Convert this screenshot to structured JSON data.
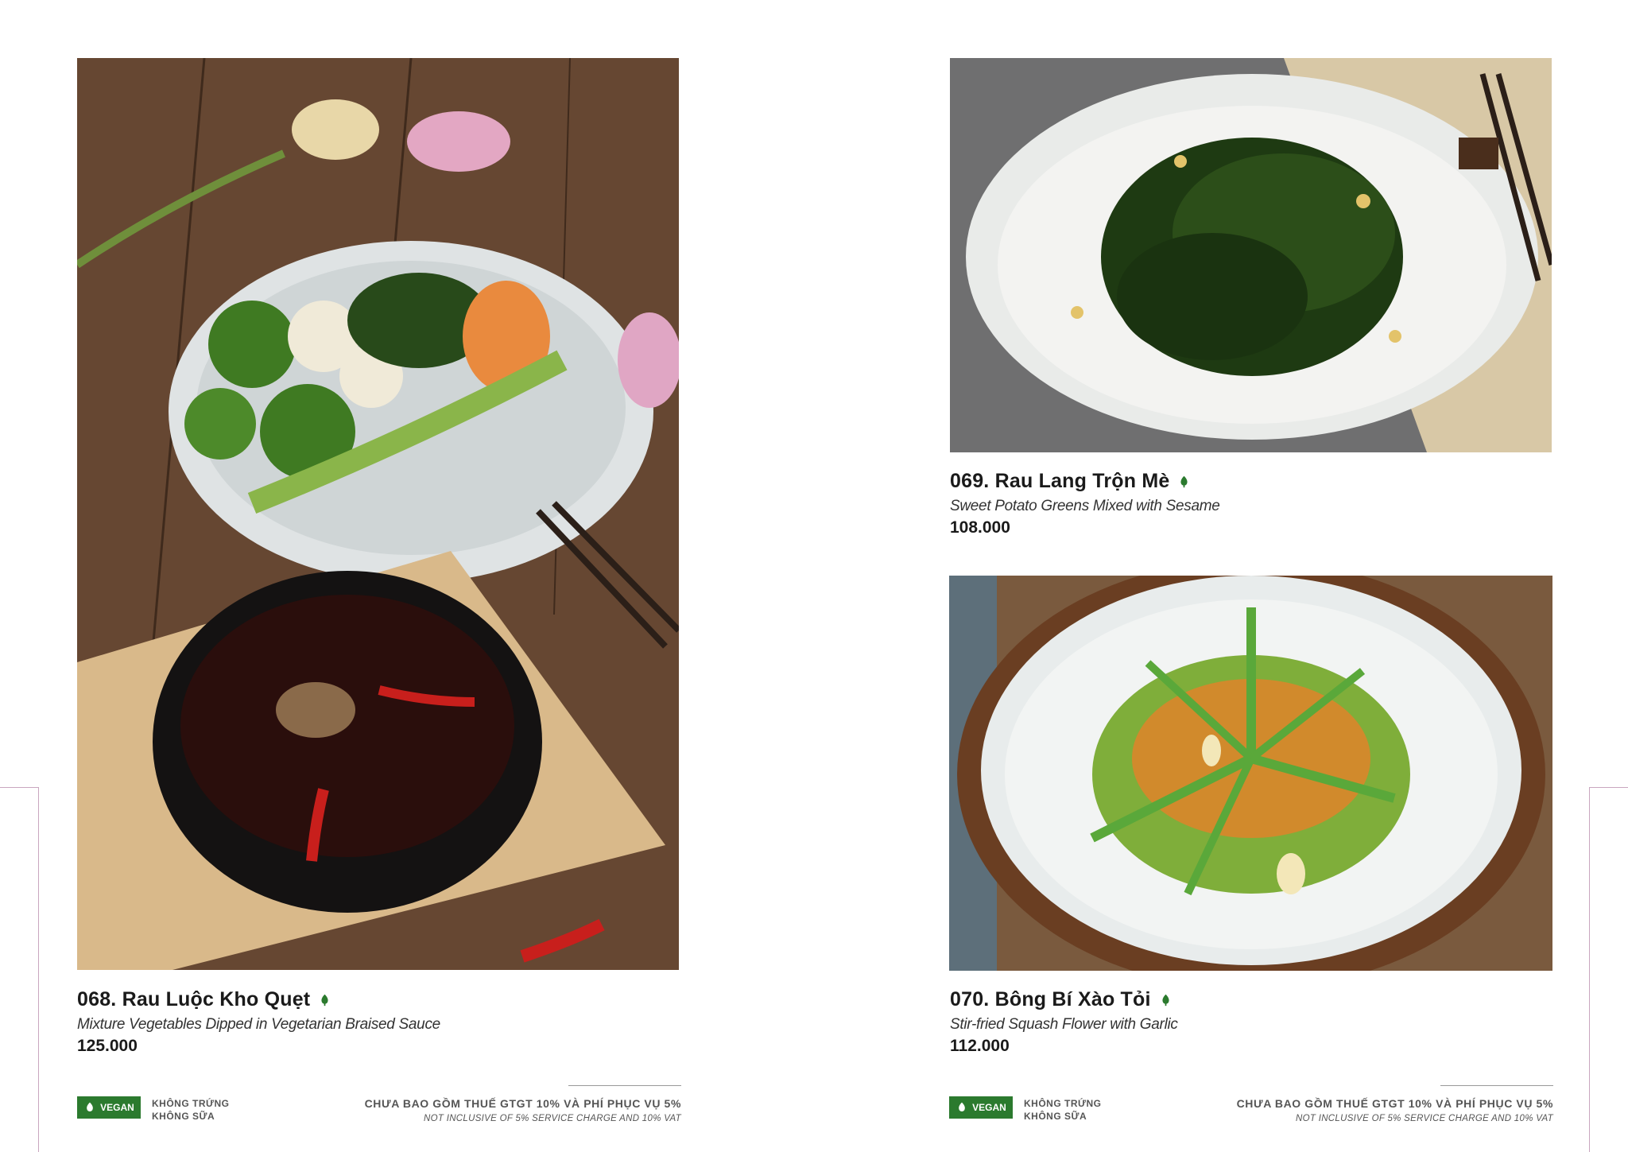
{
  "dishes": [
    {
      "code_name": "068. Rau Luộc Kho Quẹt",
      "description": "Mixture Vegetables Dipped in Vegetarian Braised Sauce",
      "price": "125.000",
      "icon": "vegan-leaf-icon"
    },
    {
      "code_name": "069. Rau Lang Trộn Mè",
      "description": "Sweet Potato Greens Mixed with Sesame",
      "price": "108.000",
      "icon": "vegan-leaf-icon"
    },
    {
      "code_name": "070. Bông Bí Xào Tỏi",
      "description": "Stir-fried Squash Flower with Garlic",
      "price": "112.000",
      "icon": "vegan-leaf-icon"
    }
  ],
  "footer": {
    "vegan_label": "VEGAN",
    "diet_line1": "KHÔNG TRỨNG",
    "diet_line2": "KHÔNG SỮA",
    "tax_vn": "CHƯA BAO GỒM THUẾ GTGT 10% VÀ PHÍ PHỤC VỤ 5%",
    "tax_en": "NOT INCLUSIVE OF 5% SERVICE CHARGE AND 10% VAT"
  },
  "colors": {
    "vegan_green": "#2b7a2e",
    "edge_line": "#c9a6bf"
  }
}
